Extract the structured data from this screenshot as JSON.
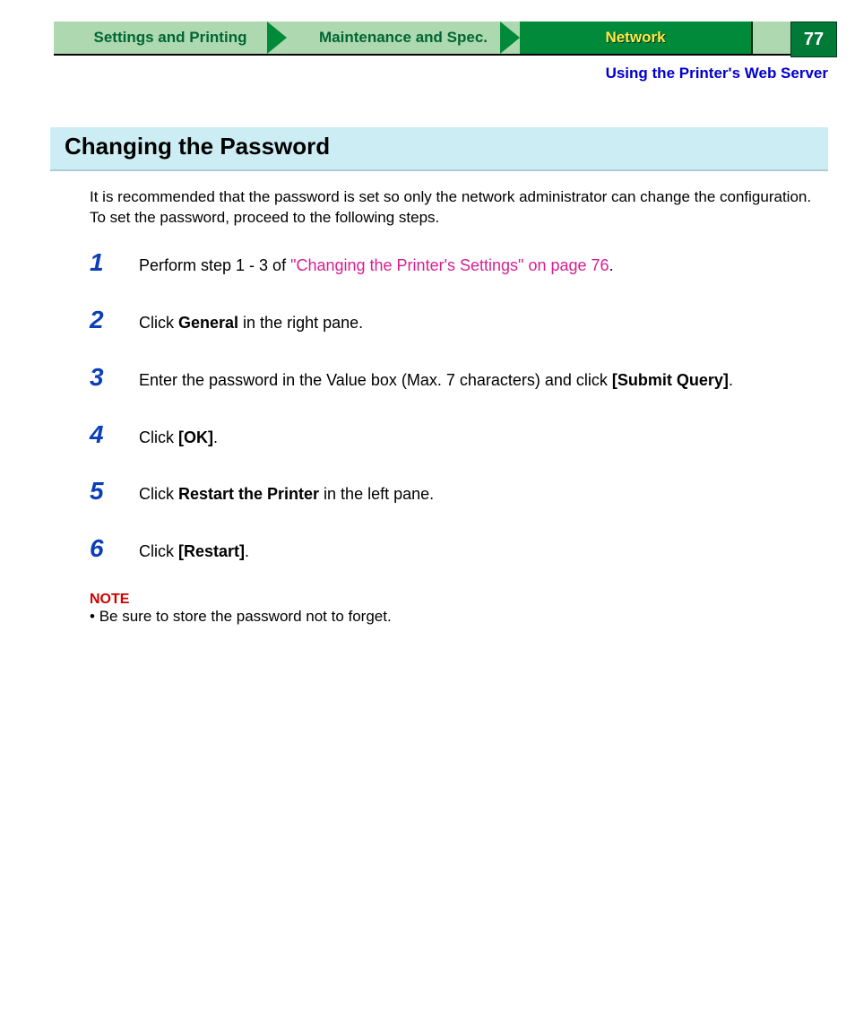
{
  "tabs": {
    "settings": "Settings and Printing",
    "maintenance": "Maintenance and Spec.",
    "network": "Network"
  },
  "page_number": "77",
  "subtitle": "Using the Printer's Web Server",
  "heading": "Changing the Password",
  "intro": "It is recommended that the password is set so only the network administrator can change the configuration. To set the password, proceed to the following steps.",
  "steps": {
    "s1": {
      "num": "1",
      "pre": "Perform step 1 - 3 of ",
      "link": "\"Changing the Printer's Settings\" on page 76",
      "post": "."
    },
    "s2": {
      "num": "2",
      "pre": "Click ",
      "b1": "General",
      "post": " in the right pane."
    },
    "s3": {
      "num": "3",
      "pre": "Enter the password in the Value box (Max. 7 characters) and click ",
      "b1": "[Submit Query]",
      "post": "."
    },
    "s4": {
      "num": "4",
      "pre": "Click ",
      "b1": "[OK]",
      "post": "."
    },
    "s5": {
      "num": "5",
      "pre": "Click ",
      "b1": "Restart the Printer",
      "post": " in the left pane."
    },
    "s6": {
      "num": "6",
      "pre": "Click ",
      "b1": "[Restart]",
      "post": "."
    }
  },
  "note_label": "NOTE",
  "note_bullet": "• ",
  "note_text": "Be sure to store the password not to forget."
}
